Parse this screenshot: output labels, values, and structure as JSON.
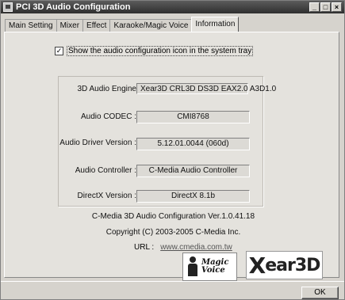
{
  "window": {
    "title": "PCI 3D Audio Configuration",
    "controls": [
      "_",
      "□",
      "×"
    ]
  },
  "tabs": [
    {
      "label": "Main Setting",
      "active": false
    },
    {
      "label": "Mixer",
      "active": false
    },
    {
      "label": "Effect",
      "active": false
    },
    {
      "label": "Karaoke/Magic Voice",
      "active": false
    },
    {
      "label": "Information",
      "active": true
    }
  ],
  "show_icon": {
    "checked": true,
    "label": "Show the audio configuration icon in the system tray"
  },
  "info": [
    {
      "label": "3D Audio Engine",
      "value": "Xear3D  CRL3D  DS3D  EAX2.0  A3D1.0"
    },
    {
      "label": "Audio CODEC :",
      "value": "CMI8768"
    },
    {
      "label": "Audio Driver Version :",
      "value": "5.12.01.0044 (060d)"
    },
    {
      "label": "Audio Controller :",
      "value": "C-Media Audio Controller"
    },
    {
      "label": "DirectX Version :",
      "value": "DirectX 8.1b"
    }
  ],
  "footer": {
    "version": "C-Media 3D Audio Configuration Ver.1.0.41.18",
    "copyright": "Copyright (C) 2003-2005 C-Media Inc.",
    "url_label": "URL :",
    "url": "www.cmedia.com.tw"
  },
  "logos": {
    "magic_voice_line1": "Magic",
    "magic_voice_line2": "Voice",
    "xear3d_x": "X",
    "xear3d_rest": "ear3D"
  },
  "ok_label": "OK"
}
